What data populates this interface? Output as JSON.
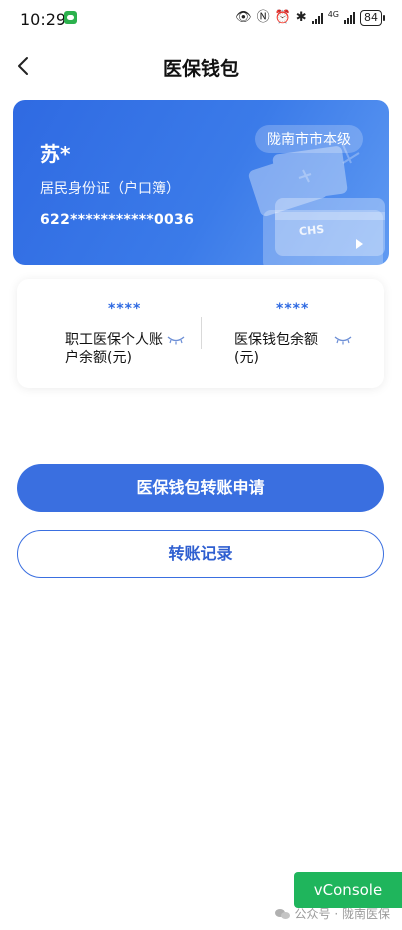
{
  "status_bar": {
    "time": "10:29",
    "battery": "84",
    "network": "4G"
  },
  "header": {
    "title": "医保钱包"
  },
  "card": {
    "holder_name": "苏*",
    "id_type": "居民身份证（户口簿）",
    "card_number": "622***********0036",
    "region": "陇南市市本级",
    "logo_text": "CHS",
    "colors": {
      "start": "#2f6ae2",
      "end": "#5f9af2"
    }
  },
  "balances": [
    {
      "value": "****",
      "label": "职工医保个人账户余额(元)"
    },
    {
      "value": "****",
      "label": "医保钱包余额(元)"
    }
  ],
  "actions": {
    "transfer_apply": "医保钱包转账申请",
    "transfer_records": "转账记录"
  },
  "vconsole": {
    "label": "vConsole"
  },
  "watermark": {
    "text": "公众号 · 陇南医保"
  },
  "colors": {
    "accent": "#3a6fe0",
    "vconsole": "#1fb55c"
  }
}
